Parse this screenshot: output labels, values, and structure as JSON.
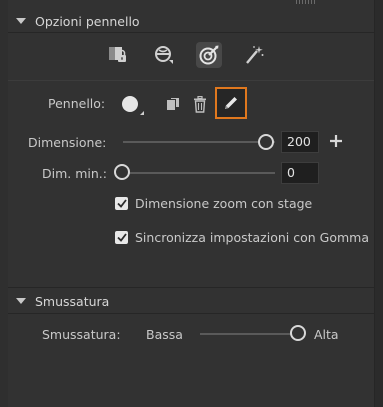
{
  "brush_options": {
    "title": "Opzioni pennello",
    "modes": [
      {
        "name": "paint-fills-icon"
      },
      {
        "name": "paint-inside-icon"
      },
      {
        "name": "paint-selection-icon",
        "active": true
      },
      {
        "name": "paint-magic-icon"
      }
    ],
    "brush_label": "Pennello:",
    "size_label": "Dimensione:",
    "size_value": "200",
    "size_fraction": 1.0,
    "min_size_label": "Dim. min.:",
    "min_size_value": "0",
    "min_size_fraction": 0.0,
    "zoom_checkbox_label": "Dimensione zoom con stage",
    "zoom_checked": true,
    "sync_checkbox_label": "Sincronizza impostazioni con Gomma",
    "sync_checked": true
  },
  "smoothing": {
    "title": "Smussatura",
    "label": "Smussatura:",
    "low_label": "Bassa",
    "high_label": "Alta",
    "fraction": 1.0
  },
  "colors": {
    "accent": "#e0781e",
    "panel_bg": "#323232",
    "field_bg": "#1f1f1f"
  }
}
